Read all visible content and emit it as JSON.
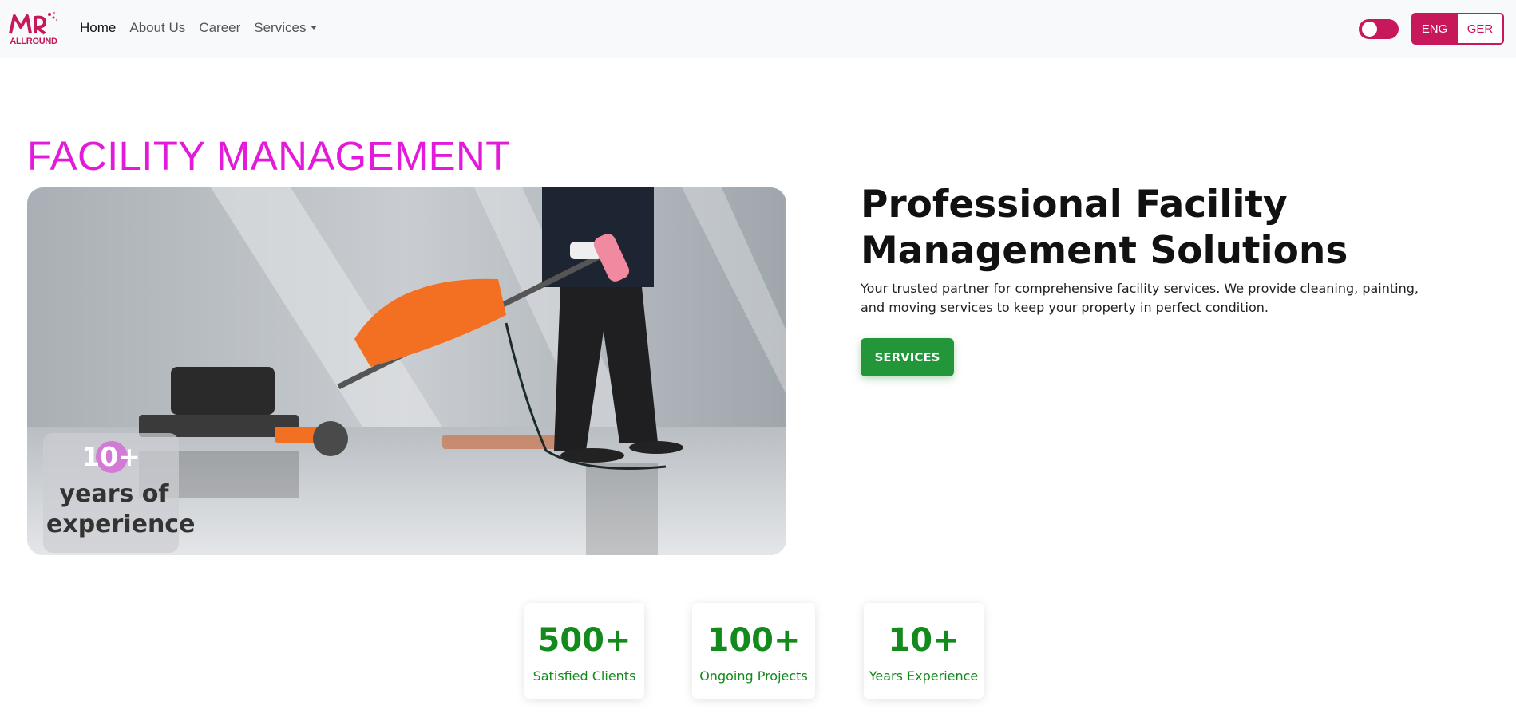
{
  "navbar": {
    "logo_text": "ALLROUND",
    "links": [
      {
        "label": "Home"
      },
      {
        "label": "About Us"
      },
      {
        "label": "Career"
      },
      {
        "label": "Services"
      }
    ],
    "lang_active": "ENG",
    "lang_other": "GER"
  },
  "hero": {
    "title": "FACILITY MANAGEMENT",
    "badge_number": "10+",
    "badge_text": "years of experience"
  },
  "intro": {
    "heading": "Professional Facility Management Solutions",
    "description": "Your trusted partner for comprehensive facility services. We provide cleaning, painting, and moving services to keep your property in perfect condition.",
    "button_label": "SERVICES"
  },
  "stats": [
    {
      "value": "500+",
      "label": "Satisfied Clients"
    },
    {
      "value": "100+",
      "label": "Ongoing Projects"
    },
    {
      "value": "10+",
      "label": "Years Experience"
    }
  ],
  "colors": {
    "brand": "#c8185c",
    "title_magenta": "#e31ad9",
    "stat_green": "#138a1c",
    "button_green": "#23963a"
  },
  "icons": {
    "dropdown": "chevron-down-icon",
    "theme_toggle": "toggle-icon"
  }
}
